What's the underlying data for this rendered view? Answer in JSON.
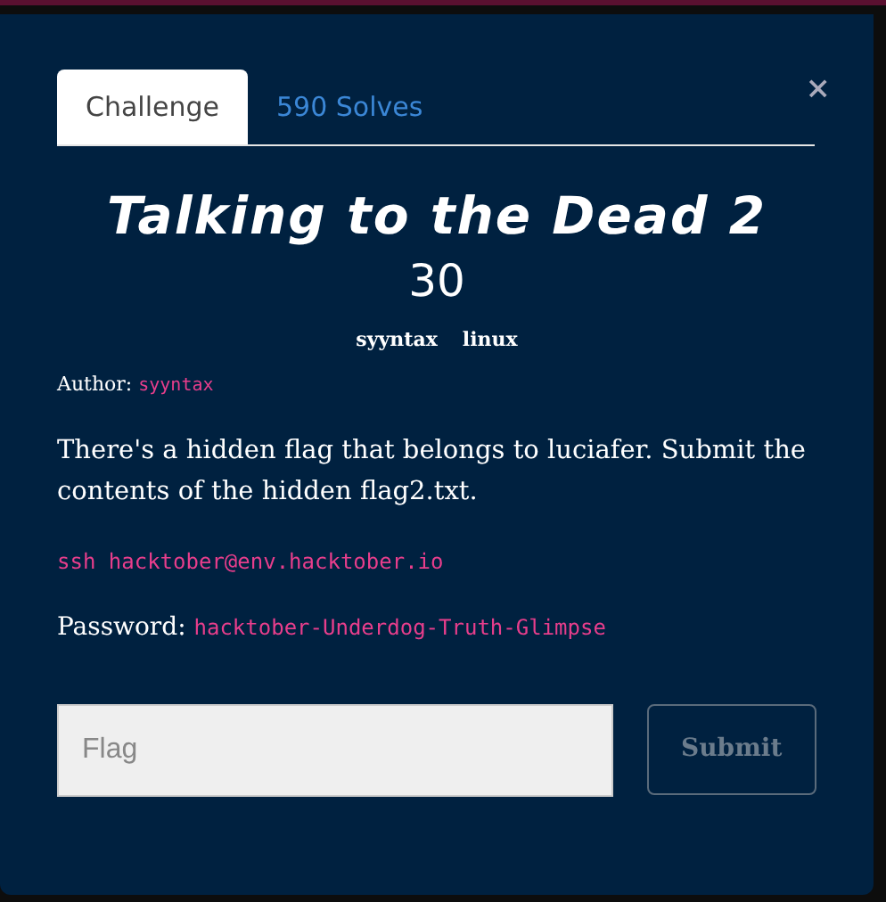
{
  "tabs": [
    {
      "label": "Challenge",
      "selected": true
    },
    {
      "label": "590 Solves",
      "selected": false
    }
  ],
  "close": "×",
  "challenge": {
    "title": "Talking to the Dead 2",
    "points": "30",
    "tags": [
      "syyntax",
      "linux"
    ],
    "author_label": "Author:",
    "author": "syyntax",
    "description": "There's a hidden flag that belongs to luciafer. Submit the contents of the hidden flag2.txt.",
    "command": "ssh hacktober@env.hacktober.io",
    "password_label": "Password:",
    "password": "hacktober-Underdog-Truth-Glimpse"
  },
  "flag_field": {
    "placeholder": "Flag"
  },
  "submit_button": "Submit"
}
